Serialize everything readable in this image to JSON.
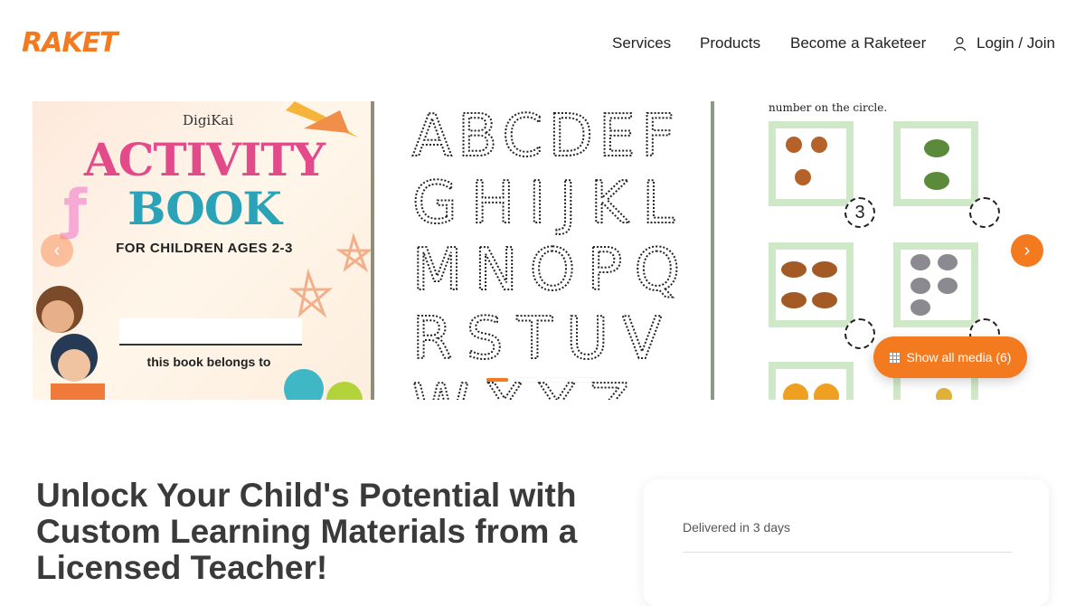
{
  "header": {
    "logo": "RAKET",
    "nav": {
      "services": "Services",
      "products": "Products",
      "become": "Become a Raketeer",
      "login": "Login / Join"
    }
  },
  "carousel": {
    "slide1": {
      "brand": "DigiKai",
      "title_line1": "ACTIVITY",
      "title_line2": "BOOK",
      "subtitle": "FOR CHILDREN AGES 2-3",
      "belongs": "this book belongs to"
    },
    "slide2": {
      "rows": [
        "ABCDEF",
        "GHIJKL",
        "MNOPQ",
        "RSTUV",
        "WXYZ"
      ]
    },
    "slide3": {
      "instruction": "number on the circle.",
      "answer": "3"
    },
    "dots_total": 4,
    "dots_active": 1,
    "show_media_label": "Show all media (6)"
  },
  "main": {
    "headline": "Unlock Your Child's Potential with Custom Learning Materials from a Licensed Teacher!"
  },
  "card": {
    "delivered": "Delivered in 3 days"
  },
  "colors": {
    "accent": "#f47a20",
    "headline": "#3a3a3a"
  }
}
